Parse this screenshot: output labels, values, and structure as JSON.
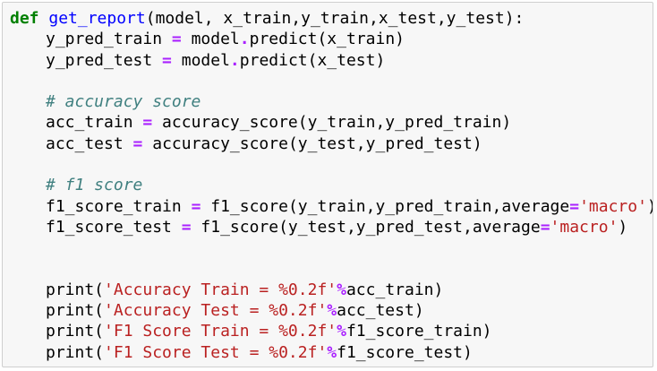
{
  "cell": {
    "lines": [
      {
        "type": "code",
        "indent": 0,
        "tokens": [
          {
            "k": "kw",
            "t": "def"
          },
          {
            "k": "txt",
            "t": " "
          },
          {
            "k": "fn",
            "t": "get_report"
          },
          {
            "k": "txt",
            "t": "(model, x_train,y_train,x_test,y_test):"
          }
        ]
      },
      {
        "type": "code",
        "indent": 1,
        "tokens": [
          {
            "k": "txt",
            "t": "y_pred_train "
          },
          {
            "k": "op",
            "t": "="
          },
          {
            "k": "txt",
            "t": " model"
          },
          {
            "k": "op",
            "t": "."
          },
          {
            "k": "txt",
            "t": "predict(x_train)"
          }
        ]
      },
      {
        "type": "code",
        "indent": 1,
        "tokens": [
          {
            "k": "txt",
            "t": "y_pred_test "
          },
          {
            "k": "op",
            "t": "="
          },
          {
            "k": "txt",
            "t": " model"
          },
          {
            "k": "op",
            "t": "."
          },
          {
            "k": "txt",
            "t": "predict(x_test)"
          }
        ]
      },
      {
        "type": "blank"
      },
      {
        "type": "code",
        "indent": 1,
        "tokens": [
          {
            "k": "cm",
            "t": "# accuracy score"
          }
        ]
      },
      {
        "type": "code",
        "indent": 1,
        "tokens": [
          {
            "k": "txt",
            "t": "acc_train "
          },
          {
            "k": "op",
            "t": "="
          },
          {
            "k": "txt",
            "t": " accuracy_score(y_train,y_pred_train)"
          }
        ]
      },
      {
        "type": "code",
        "indent": 1,
        "tokens": [
          {
            "k": "txt",
            "t": "acc_test "
          },
          {
            "k": "op",
            "t": "="
          },
          {
            "k": "txt",
            "t": " accuracy_score(y_test,y_pred_test)"
          }
        ]
      },
      {
        "type": "blank"
      },
      {
        "type": "code",
        "indent": 1,
        "tokens": [
          {
            "k": "cm",
            "t": "# f1 score"
          }
        ]
      },
      {
        "type": "code",
        "indent": 1,
        "tokens": [
          {
            "k": "txt",
            "t": "f1_score_train "
          },
          {
            "k": "op",
            "t": "="
          },
          {
            "k": "txt",
            "t": " f1_score(y_train,y_pred_train,average"
          },
          {
            "k": "op",
            "t": "="
          },
          {
            "k": "str",
            "t": "'macro'"
          },
          {
            "k": "txt",
            "t": ")"
          }
        ]
      },
      {
        "type": "code",
        "indent": 1,
        "tokens": [
          {
            "k": "txt",
            "t": "f1_score_test "
          },
          {
            "k": "op",
            "t": "="
          },
          {
            "k": "txt",
            "t": " f1_score(y_test,y_pred_test,average"
          },
          {
            "k": "op",
            "t": "="
          },
          {
            "k": "str",
            "t": "'macro'"
          },
          {
            "k": "txt",
            "t": ")"
          }
        ]
      },
      {
        "type": "blank"
      },
      {
        "type": "blank"
      },
      {
        "type": "code",
        "indent": 1,
        "tokens": [
          {
            "k": "txt",
            "t": "print("
          },
          {
            "k": "str",
            "t": "'Accuracy Train = %0.2f'"
          },
          {
            "k": "op",
            "t": "%"
          },
          {
            "k": "txt",
            "t": "acc_train)"
          }
        ]
      },
      {
        "type": "code",
        "indent": 1,
        "tokens": [
          {
            "k": "txt",
            "t": "print("
          },
          {
            "k": "str",
            "t": "'Accuracy Test = %0.2f'"
          },
          {
            "k": "op",
            "t": "%"
          },
          {
            "k": "txt",
            "t": "acc_test)"
          }
        ]
      },
      {
        "type": "code",
        "indent": 1,
        "tokens": [
          {
            "k": "txt",
            "t": "print("
          },
          {
            "k": "str",
            "t": "'F1 Score Train = %0.2f'"
          },
          {
            "k": "op",
            "t": "%"
          },
          {
            "k": "txt",
            "t": "f1_score_train)"
          }
        ]
      },
      {
        "type": "code",
        "indent": 1,
        "tokens": [
          {
            "k": "txt",
            "t": "print("
          },
          {
            "k": "str",
            "t": "'F1 Score Test = %0.2f'"
          },
          {
            "k": "op",
            "t": "%"
          },
          {
            "k": "txt",
            "t": "f1_score_test)"
          }
        ]
      }
    ]
  },
  "colors": {
    "keyword": "#008000",
    "function_name": "#0000ff",
    "operator": "#aa22ff",
    "string": "#ba2121",
    "comment": "#408080",
    "cell_background": "#f7f7f7",
    "cell_border": "#cfcfcf"
  }
}
